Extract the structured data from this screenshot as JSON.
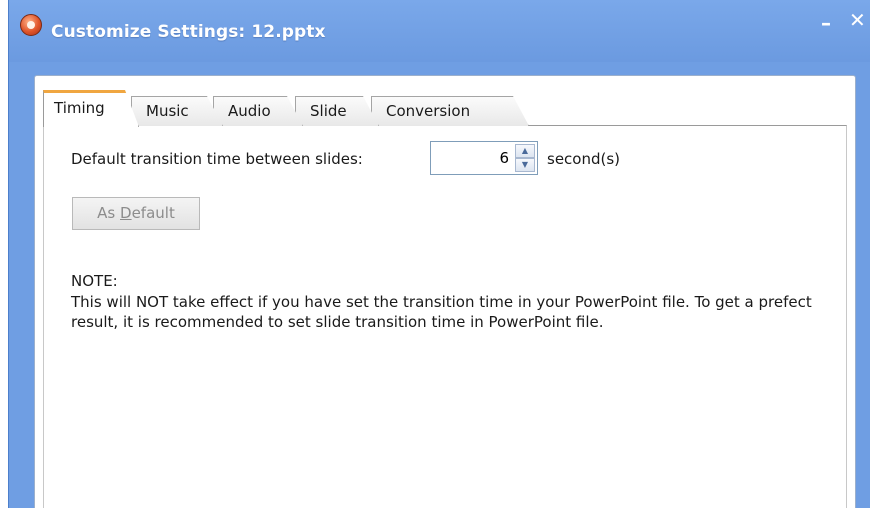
{
  "window": {
    "title": "Customize Settings: 12.pptx",
    "minimize_glyph": "–",
    "close_glyph": "✕",
    "app_icon": "app-logo-icon"
  },
  "tabs": [
    {
      "label": "Timing",
      "active": true
    },
    {
      "label": "Music",
      "active": false
    },
    {
      "label": "Audio",
      "active": false
    },
    {
      "label": "Slide",
      "active": false
    },
    {
      "label": "Conversion",
      "active": false
    }
  ],
  "timing": {
    "transition_label": "Default transition time between slides:",
    "transition_value": "6",
    "unit_label": "second(s)",
    "spin_up_glyph": "▲",
    "spin_down_glyph": "▼",
    "as_default_prefix": "As ",
    "as_default_mnemonic": "D",
    "as_default_suffix": "efault",
    "note_heading": "NOTE:",
    "note_text": "This will NOT take effect if you have set the transition time in your PowerPoint file. To get a prefect result, it is recommended to set slide transition time in PowerPoint file."
  },
  "colors": {
    "title_bar": "#6f9ee3",
    "active_tab_accent": "#f0a640"
  }
}
